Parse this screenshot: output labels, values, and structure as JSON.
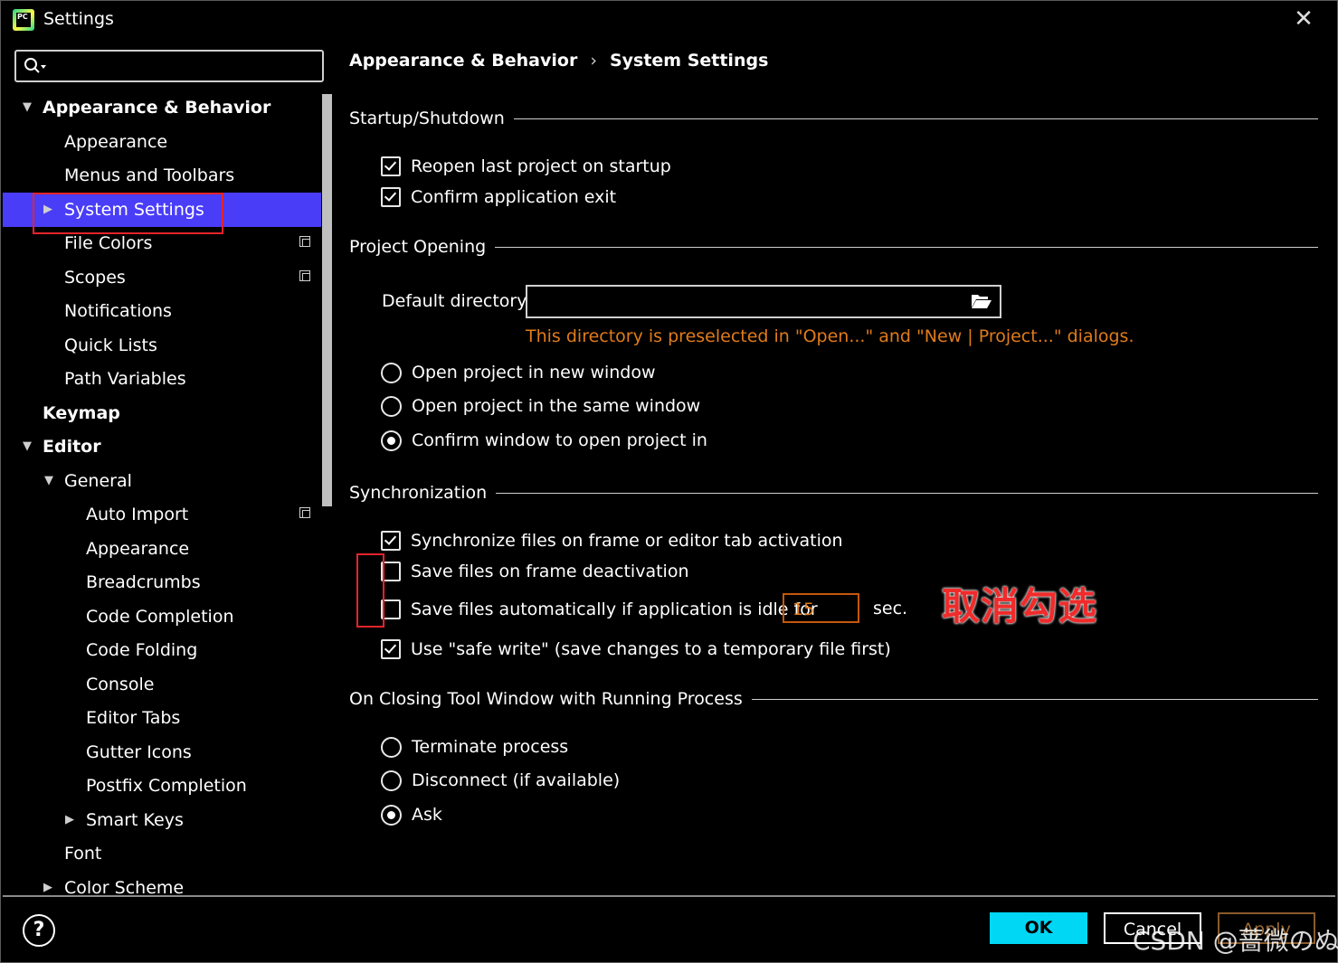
{
  "window": {
    "title": "Settings",
    "app_icon_text": "PC",
    "close_glyph": "✕"
  },
  "search": {
    "value": "",
    "placeholder": ""
  },
  "tree": {
    "items": [
      {
        "label": "Appearance & Behavior",
        "arrow": "▼"
      },
      {
        "label": "Appearance"
      },
      {
        "label": "Menus and Toolbars"
      },
      {
        "label": "System Settings",
        "arrow": "▶"
      },
      {
        "label": "File Colors"
      },
      {
        "label": "Scopes"
      },
      {
        "label": "Notifications"
      },
      {
        "label": "Quick Lists"
      },
      {
        "label": "Path Variables"
      },
      {
        "label": "Keymap"
      },
      {
        "label": "Editor",
        "arrow": "▼"
      },
      {
        "label": "General",
        "arrow": "▼"
      },
      {
        "label": "Auto Import"
      },
      {
        "label": "Appearance"
      },
      {
        "label": "Breadcrumbs"
      },
      {
        "label": "Code Completion"
      },
      {
        "label": "Code Folding"
      },
      {
        "label": "Console"
      },
      {
        "label": "Editor Tabs"
      },
      {
        "label": "Gutter Icons"
      },
      {
        "label": "Postfix Completion"
      },
      {
        "label": "Smart Keys",
        "arrow": "▶"
      },
      {
        "label": "Font"
      },
      {
        "label": "Color Scheme",
        "arrow": "▶"
      }
    ]
  },
  "breadcrumb": {
    "parent": "Appearance & Behavior",
    "separator": "›",
    "current": "System Settings"
  },
  "startup": {
    "title": "Startup/Shutdown",
    "reopen_label": "Reopen last project on startup",
    "confirm_exit_label": "Confirm application exit"
  },
  "project_opening": {
    "title": "Project Opening",
    "default_dir_label": "Default directory:",
    "default_dir_value": "",
    "hint": "This directory is preselected in \"Open...\" and \"New | Project...\" dialogs.",
    "radio_new_window": "Open project in new window",
    "radio_same_window": "Open project in the same window",
    "radio_confirm": "Confirm window to open project in"
  },
  "sync": {
    "title": "Synchronization",
    "sync_files_label": "Synchronize files on frame or editor tab activation",
    "save_deactivation_label": "Save files on frame deactivation",
    "save_idle_label": "Save files automatically if application is idle for",
    "idle_seconds": "15",
    "sec_label": "sec.",
    "safe_write_label": "Use \"safe write\" (save changes to a temporary file first)",
    "annotation": "取消勾选"
  },
  "closing": {
    "title": "On Closing Tool Window with Running Process",
    "terminate": "Terminate process",
    "disconnect": "Disconnect (if available)",
    "ask": "Ask"
  },
  "footer": {
    "help": "?",
    "ok": "OK",
    "cancel": "Cancel",
    "apply": "Apply",
    "watermark": "CSDN @蔷微のぬ"
  },
  "colors": {
    "selection": "#4a3df8",
    "ok_button": "#00d7f5",
    "hint": "#e07b1a",
    "annotation_red": "#e5232b"
  }
}
